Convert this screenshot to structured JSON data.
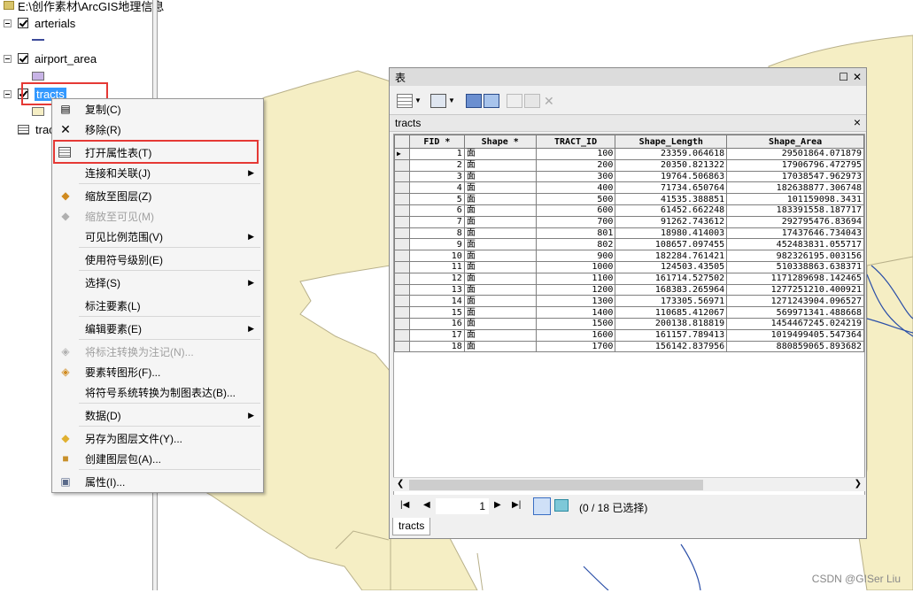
{
  "toc": {
    "path": "E:\\创作素材\\ArcGIS地理信息",
    "layers": [
      {
        "name": "arterials"
      },
      {
        "name": "airport_area"
      },
      {
        "name": "tracts"
      },
      {
        "name": "trac"
      }
    ]
  },
  "context_menu": {
    "items": [
      {
        "label": "复制(C)",
        "icon": "copy-icon",
        "enabled": true
      },
      {
        "label": "移除(R)",
        "icon": "remove-icon",
        "enabled": true
      },
      {
        "label": "打开属性表(T)",
        "icon": "table-icon",
        "enabled": true
      },
      {
        "label": "连接和关联(J)",
        "icon": "",
        "enabled": true,
        "submenu": true
      },
      {
        "label": "缩放至图层(Z)",
        "icon": "zoom-layer-icon",
        "enabled": true
      },
      {
        "label": "缩放至可见(M)",
        "icon": "zoom-visible-icon",
        "enabled": false
      },
      {
        "label": "可见比例范围(V)",
        "icon": "",
        "enabled": true,
        "submenu": true
      },
      {
        "label": "使用符号级别(E)",
        "icon": "",
        "enabled": true
      },
      {
        "label": "选择(S)",
        "icon": "",
        "enabled": true,
        "submenu": true
      },
      {
        "label": "标注要素(L)",
        "icon": "",
        "enabled": true
      },
      {
        "label": "编辑要素(E)",
        "icon": "",
        "enabled": true,
        "submenu": true
      },
      {
        "label": "将标注转换为注记(N)...",
        "icon": "convert-annotation-icon",
        "enabled": false
      },
      {
        "label": "要素转图形(F)...",
        "icon": "features-to-graphics-icon",
        "enabled": true
      },
      {
        "label": "将符号系统转换为制图表达(B)...",
        "icon": "",
        "enabled": true
      },
      {
        "label": "数据(D)",
        "icon": "",
        "enabled": true,
        "submenu": true
      },
      {
        "label": "另存为图层文件(Y)...",
        "icon": "layer-file-icon",
        "enabled": true
      },
      {
        "label": "创建图层包(A)...",
        "icon": "layer-package-icon",
        "enabled": true
      },
      {
        "label": "属性(I)...",
        "icon": "properties-icon",
        "enabled": true
      }
    ]
  },
  "table_window": {
    "title": "表",
    "tab_name": "tracts",
    "bottom_tab": "tracts",
    "columns": [
      "FID *",
      "Shape *",
      "TRACT_ID",
      "Shape_Length",
      "Shape_Area"
    ],
    "rows": [
      [
        "1",
        "面",
        "100",
        "23359.064618",
        "29501864.071879"
      ],
      [
        "2",
        "面",
        "200",
        "20350.821322",
        "17906796.472795"
      ],
      [
        "3",
        "面",
        "300",
        "19764.506863",
        "17038547.962973"
      ],
      [
        "4",
        "面",
        "400",
        "71734.650764",
        "182638877.306748"
      ],
      [
        "5",
        "面",
        "500",
        "41535.388851",
        "101159098.3431"
      ],
      [
        "6",
        "面",
        "600",
        "61452.662248",
        "183391558.187717"
      ],
      [
        "7",
        "面",
        "700",
        "91262.743612",
        "292795476.83694"
      ],
      [
        "8",
        "面",
        "801",
        "18980.414003",
        "17437646.734043"
      ],
      [
        "9",
        "面",
        "802",
        "108657.097455",
        "452483831.055717"
      ],
      [
        "10",
        "面",
        "900",
        "182284.761421",
        "982326195.003156"
      ],
      [
        "11",
        "面",
        "1000",
        "124503.43505",
        "510338863.638371"
      ],
      [
        "12",
        "面",
        "1100",
        "161714.527502",
        "1171289698.142465"
      ],
      [
        "13",
        "面",
        "1200",
        "168383.265964",
        "1277251210.400921"
      ],
      [
        "14",
        "面",
        "1300",
        "173305.56971",
        "1271243904.096527"
      ],
      [
        "15",
        "面",
        "1400",
        "110685.412067",
        "569971341.488668"
      ],
      [
        "16",
        "面",
        "1500",
        "200138.818819",
        "1454467245.024219"
      ],
      [
        "17",
        "面",
        "1600",
        "161157.789413",
        "1019499405.547364"
      ],
      [
        "18",
        "面",
        "1700",
        "156142.837956",
        "880859065.893682"
      ]
    ],
    "page": "1",
    "selection_status": "(0 / 18 已选择)"
  },
  "watermark": "CSDN @GISer Liu",
  "colors": {
    "map_land": "#f5eec4",
    "map_road": "#2b4fa8",
    "selection": "#3399ff",
    "highlight_box": "#e53935"
  }
}
